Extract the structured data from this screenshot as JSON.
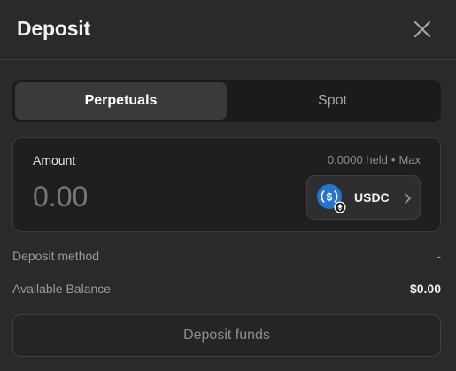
{
  "dialog": {
    "title": "Deposit",
    "close_icon": "close-icon"
  },
  "tabs": [
    {
      "label": "Perpetuals",
      "active": true
    },
    {
      "label": "Spot",
      "active": false
    }
  ],
  "amount": {
    "label": "Amount",
    "held_text": "0.0000 held",
    "separator": "•",
    "max_label": "Max",
    "value": "",
    "placeholder": "0.00"
  },
  "token": {
    "symbol": "USDC",
    "icon": "usdc-token-icon",
    "chevron_icon": "chevron-right-icon",
    "brand_color": "#2775ca"
  },
  "details": {
    "deposit_method_label": "Deposit method",
    "deposit_method_value": "-",
    "available_balance_label": "Available Balance",
    "available_balance_value": "$0.00"
  },
  "actions": {
    "deposit_label": "Deposit funds"
  }
}
